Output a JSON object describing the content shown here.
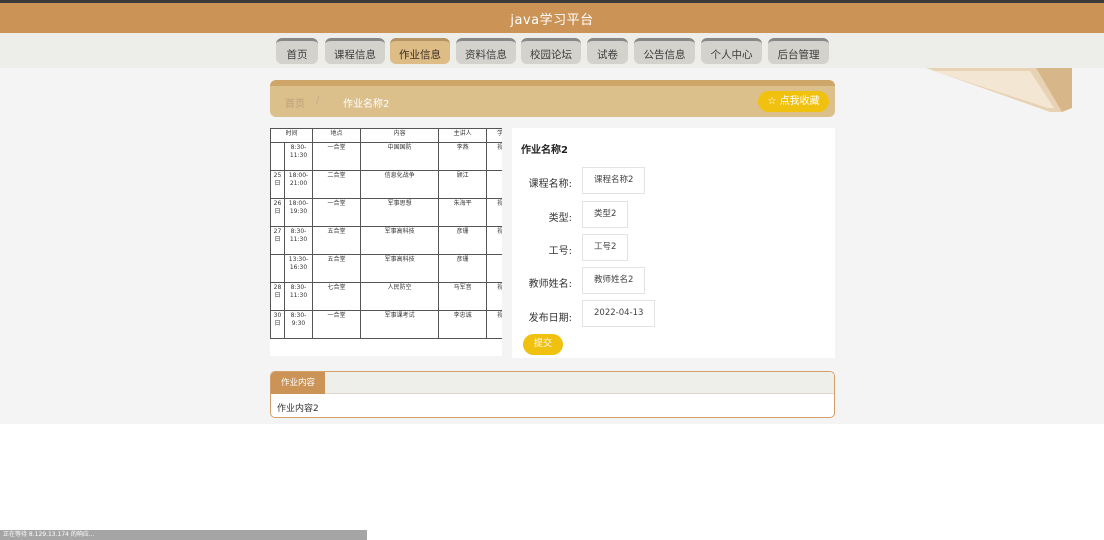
{
  "header": {
    "title": "java学习平台"
  },
  "nav": {
    "items": [
      {
        "label": "首页",
        "active": false
      },
      {
        "label": "课程信息",
        "active": false
      },
      {
        "label": "作业信息",
        "active": true
      },
      {
        "label": "资料信息",
        "active": false
      },
      {
        "label": "校园论坛",
        "active": false
      },
      {
        "label": "试卷",
        "active": false
      },
      {
        "label": "公告信息",
        "active": false
      },
      {
        "label": "个人中心",
        "active": false
      },
      {
        "label": "后台管理",
        "active": false
      }
    ]
  },
  "breadcrumb": {
    "home": "首页",
    "separator": "/",
    "current": "作业名称2",
    "favorite_button": "☆ 点我收藏"
  },
  "detail": {
    "title": "作业名称2",
    "fields": [
      {
        "label": "课程名称:",
        "value": "课程名称2"
      },
      {
        "label": "类型:",
        "value": "类型2"
      },
      {
        "label": "工号:",
        "value": "工号2"
      },
      {
        "label": "教师姓名:",
        "value": "教师姓名2"
      },
      {
        "label": "发布日期:",
        "value": "2022-04-13"
      }
    ],
    "submit_button": "提交"
  },
  "schedule_image": {
    "header": [
      "时间",
      "地点",
      "内容",
      "主讲人",
      "学院"
    ],
    "rows": [
      [
        "",
        "8:30-11:30",
        "一合堂",
        "中国国防",
        "李燕",
        "视觉"
      ],
      [
        "25日",
        "18:00-21:00",
        "二合堂",
        "信息化战争",
        "顾江",
        ""
      ],
      [
        "26日",
        "18:00-19:30",
        "一合堂",
        "军事思想",
        "朱海平",
        "视觉"
      ],
      [
        "27日",
        "8:30-11:30",
        "五合堂",
        "军事高科技",
        "彦珊",
        "视觉"
      ],
      [
        "",
        "13:30-16:30",
        "五合堂",
        "军事高科技",
        "彦珊",
        ""
      ],
      [
        "28日",
        "8:30-11:30",
        "七合堂",
        "人民防空",
        "马军音",
        "视觉"
      ],
      [
        "30日",
        "8:30-9:30",
        "一合堂",
        "军事课考试",
        "李忠诚",
        "视觉"
      ]
    ]
  },
  "tabs": {
    "items": [
      {
        "label": "作业内容",
        "active": true
      }
    ],
    "content": "作业内容2"
  },
  "statusbar": {
    "text": "正在等待 8.129.13.174 的响应..."
  },
  "colors": {
    "brand": "#cb9356",
    "nav_active": "#ddbc86",
    "accent_yellow": "#f1c10f",
    "breadcrumb_bg": "#dcc08c"
  }
}
